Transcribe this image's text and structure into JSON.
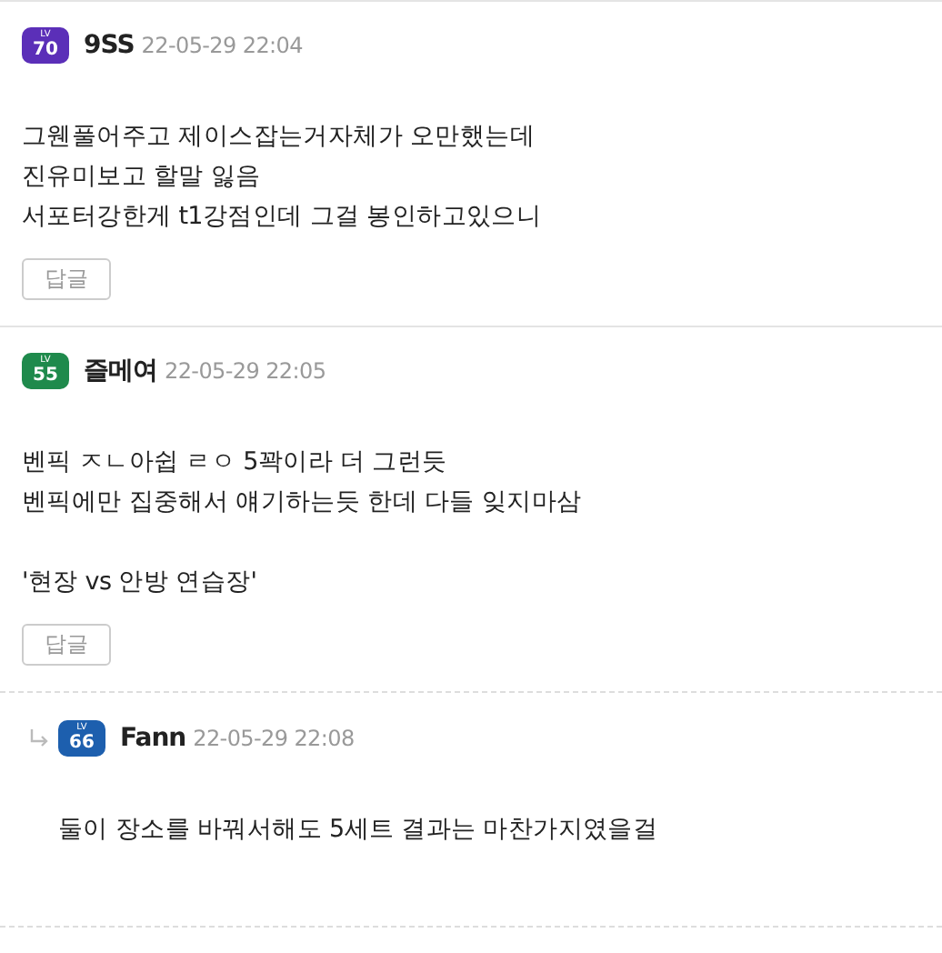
{
  "comments": [
    {
      "kind": "comment",
      "badge": {
        "label": "LV",
        "level_text": "70",
        "color": "#5b2fb8"
      },
      "author": "9SS",
      "time": "22-05-29 22:04",
      "paragraphs": [
        [
          "그웬풀어주고 제이스잡는거자체가 오만했는데",
          "진유미보고 할말 잃음",
          "서포터강한게 t1강점인데 그걸 봉인하고있으니"
        ]
      ],
      "reply_button": "답글"
    },
    {
      "kind": "comment",
      "badge": {
        "label": "LV",
        "level_text": "55",
        "color": "#1f8a4c"
      },
      "author": "즐메여",
      "time": "22-05-29 22:05",
      "paragraphs": [
        [
          "벤픽 ㅈㄴ아쉽 ㄹㅇ 5꽉이라 더 그런듯",
          "벤픽에만 집중해서 얘기하는듯 한데 다들 잊지마삼"
        ],
        [
          "'현장 vs 안방 연습장'"
        ]
      ],
      "reply_button": "답글"
    },
    {
      "kind": "reply",
      "badge": {
        "label": "LV",
        "level_text": "66",
        "color": "#1d5fae"
      },
      "author": "Fann",
      "time": "22-05-29 22:08",
      "paragraphs": [
        [
          "둘이 장소를 바꿔서해도 5세트 결과는 마찬가지였을걸"
        ]
      ]
    }
  ]
}
